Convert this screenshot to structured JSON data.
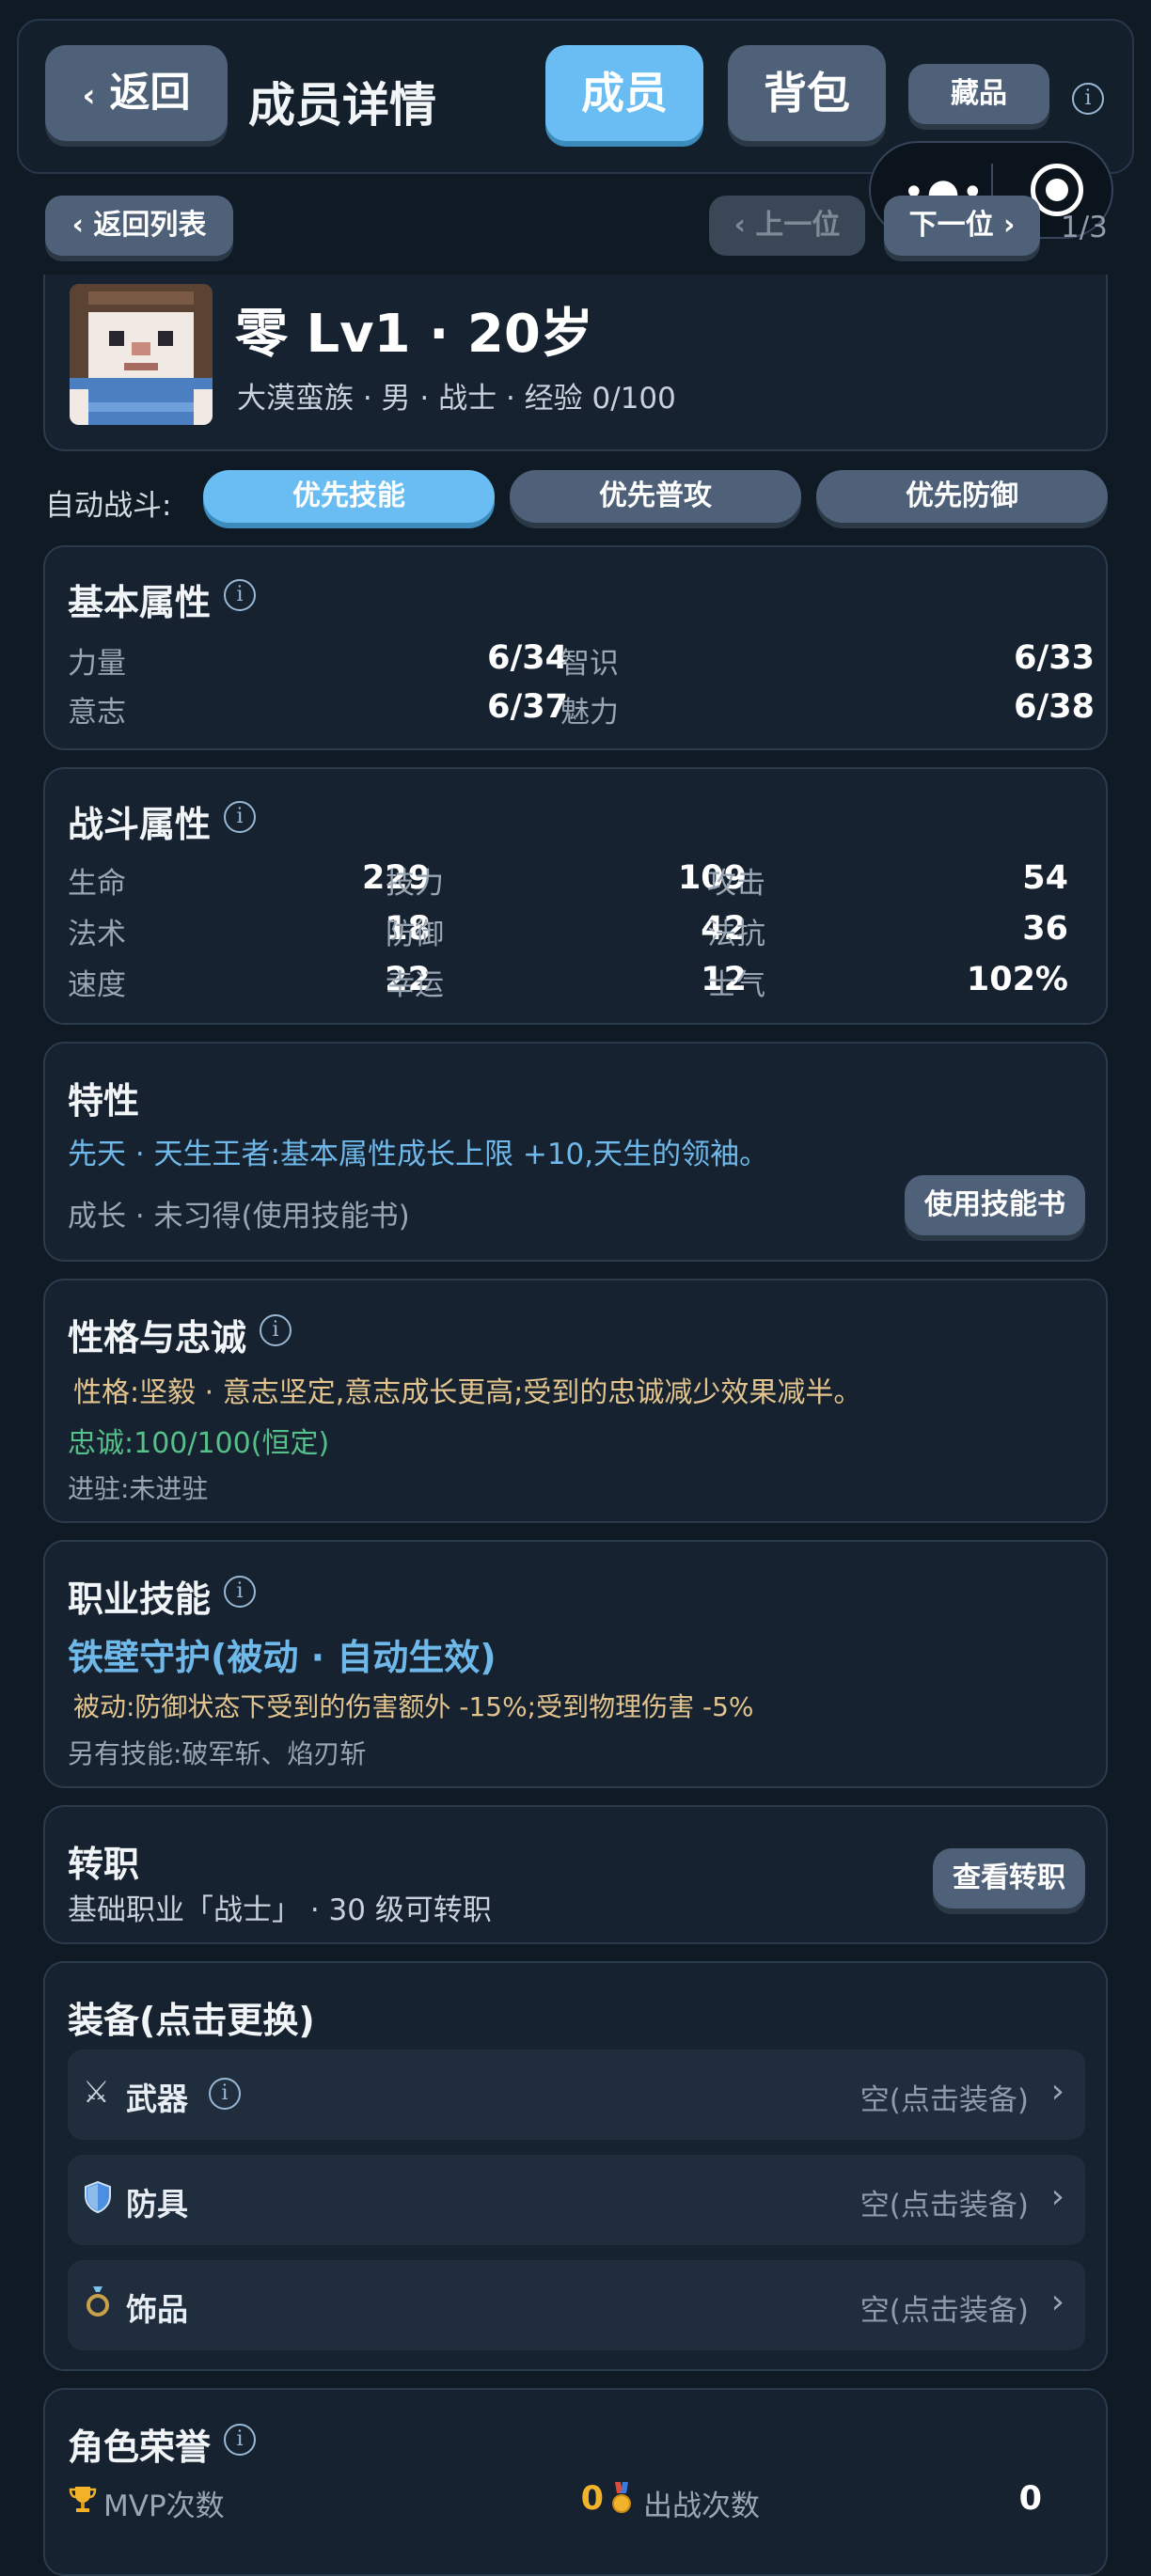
{
  "header": {
    "back_label": "返回",
    "page_title": "成员详情",
    "tab_member": "成员",
    "tab_bag": "背包",
    "tab_collection": "藏品"
  },
  "subnav": {
    "back_list": "返回列表",
    "prev": "上一位",
    "next": "下一位",
    "counter": "1/3"
  },
  "profile": {
    "name_line": "零 Lv1 · 20岁",
    "meta_line": "大漠蛮族 · 男 · 战士 · 经验 0/100"
  },
  "auto_battle": {
    "label": "自动战斗:",
    "options": [
      "优先技能",
      "优先普攻",
      "优先防御"
    ],
    "selected": "优先技能"
  },
  "basic_attrs": {
    "title": "基本属性",
    "items": [
      {
        "label": "力量",
        "value": "6/34"
      },
      {
        "label": "智识",
        "value": "6/33"
      },
      {
        "label": "意志",
        "value": "6/37"
      },
      {
        "label": "魅力",
        "value": "6/38"
      }
    ]
  },
  "combat_attrs": {
    "title": "战斗属性",
    "items": [
      {
        "label": "生命",
        "value": "229"
      },
      {
        "label": "技力",
        "value": "109"
      },
      {
        "label": "攻击",
        "value": "54"
      },
      {
        "label": "法术",
        "value": "18"
      },
      {
        "label": "防御",
        "value": "42"
      },
      {
        "label": "法抗",
        "value": "36"
      },
      {
        "label": "速度",
        "value": "22"
      },
      {
        "label": "幸运",
        "value": "12"
      },
      {
        "label": "士气",
        "value": "102%"
      }
    ]
  },
  "traits": {
    "title": "特性",
    "innate": "先天 · 天生王者:基本属性成长上限 +10,天生的领袖。",
    "growth": "成长 · 未习得(使用技能书)",
    "use_book_button": "使用技能书"
  },
  "personality": {
    "title": "性格与忠诚",
    "personality_line": "性格:坚毅 · 意志坚定,意志成长更高;受到的忠诚减少效果减半。",
    "loyalty_line": "忠诚:100/100(恒定)",
    "station_line": "进驻:未进驻"
  },
  "job_skill": {
    "title": "职业技能",
    "skill_name": "铁壁守护(被动 · 自动生效)",
    "skill_desc": "被动:防御状态下受到的伤害额外 -15%;受到物理伤害 -5%",
    "other_skills": "另有技能:破军斩、焰刃斩"
  },
  "job_change": {
    "title": "转职",
    "desc": "基础职业「战士」 · 30 级可转职",
    "button": "查看转职"
  },
  "equipment": {
    "title": "装备(点击更换)",
    "slots": [
      {
        "label": "武器",
        "value": "空(点击装备)",
        "icon": "crossed-swords-icon"
      },
      {
        "label": "防具",
        "value": "空(点击装备)",
        "icon": "shield-icon"
      },
      {
        "label": "饰品",
        "value": "空(点击装备)",
        "icon": "ring-icon"
      }
    ]
  },
  "honor": {
    "title": "角色荣誉",
    "mvp_label": "MVP次数",
    "mvp_value": "0",
    "battles_label": "出战次数",
    "battles_value": "0"
  },
  "colors": {
    "background": "#0f1a25",
    "card": "#16222f",
    "accent_blue": "#69bdf2",
    "button_gray": "#4f6178",
    "trait_blue": "#6fb8ea",
    "personality_gold": "#e3c48e",
    "loyalty_green": "#56c08a",
    "skill_blue": "#6fb8ea",
    "mvp_gold": "#f2b32b"
  }
}
